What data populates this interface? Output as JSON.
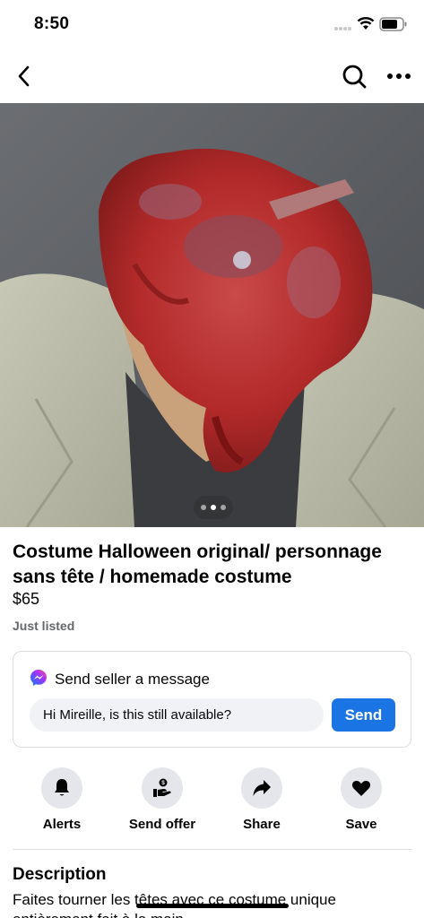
{
  "status_bar": {
    "time": "8:50",
    "icons": [
      "signal-icon",
      "wifi-icon",
      "battery-icon"
    ]
  },
  "nav": {
    "icons": [
      "back-icon",
      "search-icon",
      "more-icon"
    ]
  },
  "photo": {
    "description_icon": "product-photo",
    "page_count": 3,
    "active_page": 2
  },
  "listing": {
    "title": "Costume Halloween original/ personnage sans tête / homemade costume",
    "price": "$65",
    "listed": "Just listed"
  },
  "message": {
    "title": "Send seller a message",
    "input_value": "Hi Mireille, is this still available?",
    "send_label": "Send",
    "accent": "#1b74e4"
  },
  "actions": [
    {
      "label": "Alerts",
      "icon": "bell-icon"
    },
    {
      "label": "Send offer",
      "icon": "offer-icon"
    },
    {
      "label": "Share",
      "icon": "share-icon"
    },
    {
      "label": "Save",
      "icon": "heart-icon"
    }
  ],
  "description": {
    "title": "Description",
    "text": "Faites tourner les têtes avec ce costume unique entièrement fait à la main"
  }
}
